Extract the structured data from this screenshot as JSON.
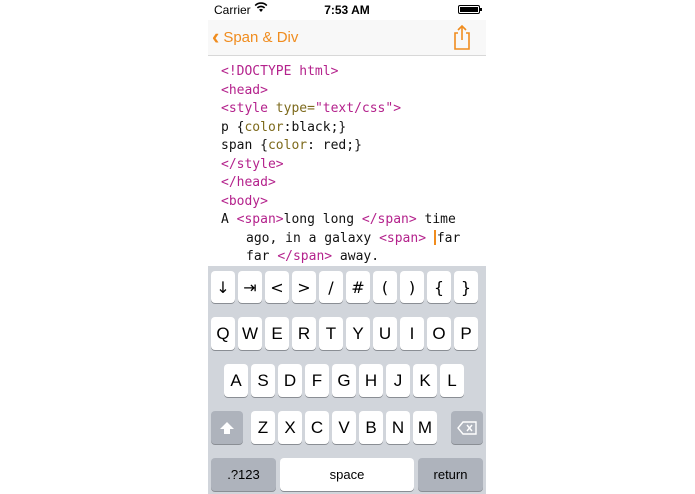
{
  "status_bar": {
    "carrier": "Carrier",
    "wifi_icon": "wifi-icon",
    "time": "7:53 AM",
    "battery_icon": "battery-icon"
  },
  "nav": {
    "back_label": "Span & Div",
    "back_icon": "chevron-left-icon",
    "share_icon": "share-icon",
    "accent": "#f08c1e"
  },
  "colors": {
    "tag": "#b4228c",
    "attribute": "#7d6a1c",
    "keyboard_bg": "#d1d5db"
  },
  "code": {
    "l1": "<!DOCTYPE html>",
    "l2": "<head>",
    "l3_tag_open": "<style ",
    "l3_attr": "type=",
    "l3_value": "\"text/css\">",
    "l4_sel": "p {",
    "l4_prop": "color",
    "l4_rest": ":black;}",
    "l5_sel": "span {",
    "l5_prop": "color",
    "l5_rest": ": red;}",
    "l6": "</style>",
    "l7": "</head>",
    "l8": "<body>",
    "l9_a": "A ",
    "l9_tag": "<span>",
    "l9_b": "long long ",
    "l9_tag2": "</span>",
    "l9_c": " time",
    "l10_a": "ago, in a galaxy ",
    "l10_tag": "<span>",
    "l10_b": " ",
    "l10_c": "far",
    "l11_a": "far ",
    "l11_tag": "</span>",
    "l11_b": " away."
  },
  "keyboard": {
    "symbols": [
      "↓",
      "⇥",
      "<",
      ">",
      "/",
      "#",
      "(",
      ")",
      "{",
      "}"
    ],
    "row1": [
      "Q",
      "W",
      "E",
      "R",
      "T",
      "Y",
      "U",
      "I",
      "O",
      "P"
    ],
    "row2": [
      "A",
      "S",
      "D",
      "F",
      "G",
      "H",
      "J",
      "K",
      "L"
    ],
    "row3": [
      "Z",
      "X",
      "C",
      "V",
      "B",
      "N",
      "M"
    ],
    "shift_icon": "shift-icon",
    "delete_icon": "delete-icon",
    "numbers_label": ".?123",
    "space_label": "space",
    "return_label": "return"
  }
}
